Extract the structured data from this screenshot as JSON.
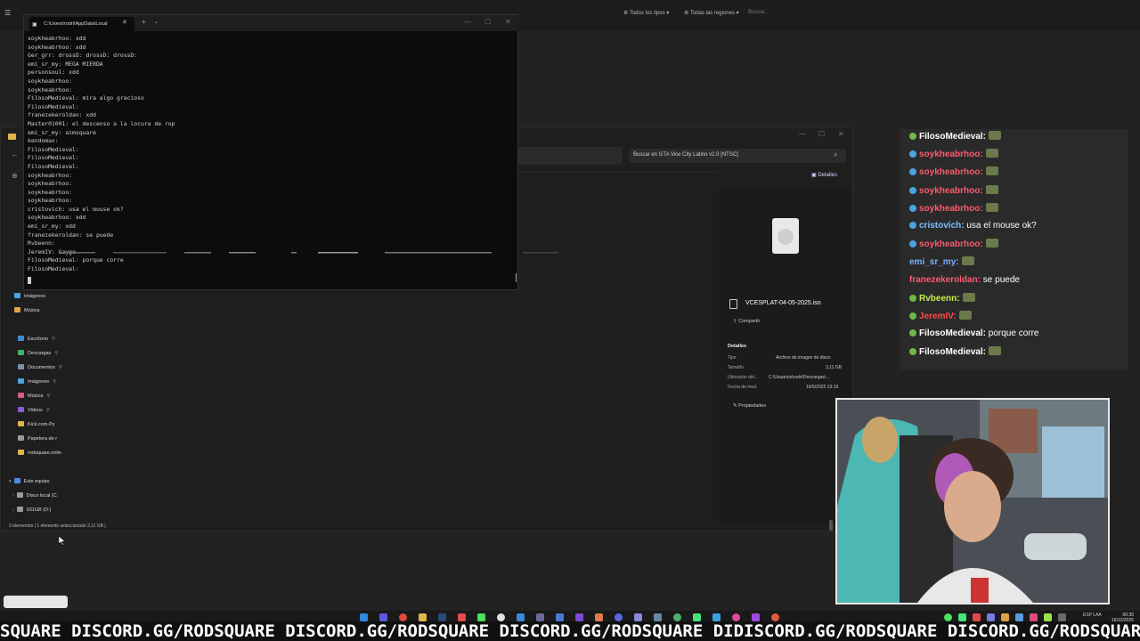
{
  "topbar": {
    "filter_types": "Todos los tipos",
    "filter_regions": "Todas las regiones",
    "search_placeholder": "Buscar..."
  },
  "terminal": {
    "tab_title": "C:\\Users\\rodri\\AppData\\Local",
    "lines": [
      "soykheabrhoo: xdd",
      "soykheabrhoo: xdd",
      "Ger_grr: drossD: drossD: drossD:",
      "emi_sr_my: MEGA MIERDA",
      "personsoul: xdd",
      "soykheabrhoo:",
      "soykheabrhoo:",
      "FilosoMedieval: mira algo gracioso",
      "FilosoMedieval:",
      "franezekeroldan: xdd",
      "Master01001: el descenso a la locura de rop",
      "emi_sr_my: aimsquare",
      "kendomax:",
      "FilosoMedieval:",
      "FilosoMedieval:",
      "FilosoMedieval:",
      "soykheabrhoo:",
      "soykheabrhoo:",
      "soykheabrhoo:",
      "soykheabrhoo:",
      "cristovich: usa el mouse ok?",
      "soykheabrhoo: xdd",
      "emi_sr_my: xdd",
      "franezekeroldan: se puede",
      "Rvbeenn:",
      "JeremIV: Gayge",
      "FilosoMedieval: porque corre",
      "FilosoMedieval:"
    ]
  },
  "explorer": {
    "search_placeholder": "Buscar en GTA Vice City Latino v2.0 [NTSC]",
    "details_button": "Detalles",
    "nav_items": [
      {
        "label": "Imágenes",
        "color": "#4aa3e0"
      },
      {
        "label": "Música",
        "color": "#e0a24a"
      },
      {
        "label": "Escritorio",
        "color": "#3d8fd8"
      },
      {
        "label": "Descargas",
        "color": "#3fb36a"
      },
      {
        "label": "Documentos",
        "color": "#7a8fb0"
      },
      {
        "label": "Imágenes",
        "color": "#4aa3e0"
      },
      {
        "label": "Música",
        "color": "#d65a8a"
      },
      {
        "label": "Videos",
        "color": "#8a5ad6"
      },
      {
        "label": "Kick.com-Py",
        "color": "#e0b64a"
      },
      {
        "label": "Papelera de r",
        "color": "#9a9a9a"
      },
      {
        "label": "rodsquare.onlin",
        "color": "#e0b64a"
      },
      {
        "label": "Este equipo",
        "color": "#4a8ee0"
      },
      {
        "label": "Disco local (C:",
        "color": "#9a9a9a"
      },
      {
        "label": "931GB (D:)",
        "color": "#9a9a9a"
      }
    ],
    "file_name": "VCESPLAT-04-05-2025.iso",
    "share_label": "Compartir",
    "details_heading": "Detalles",
    "props": [
      {
        "key": "Tipo",
        "value": "Archivo de imagen de disco"
      },
      {
        "key": "Tamaño",
        "value": "3,11 GB"
      },
      {
        "key": "Ubicación del...",
        "value": "C:\\Usuarios\\rodri\\Descargas\\..."
      },
      {
        "key": "Fecha de mod.",
        "value": "16/5/2025 13:19"
      }
    ],
    "properties_label": "Propiedades",
    "status": "3 elementos  |  1 elemento seleccionado  3,11 GB  |"
  },
  "chat": {
    "messages": [
      {
        "user": "FilosoMedieval:",
        "text": "",
        "color": "#ffffff",
        "badge": "#6fb84a",
        "emote": true
      },
      {
        "user": "soykheabrhoo:",
        "text": "",
        "color": "#ff5a6e",
        "badge": "#4aa3e0",
        "emote": true
      },
      {
        "user": "soykheabrhoo:",
        "text": "",
        "color": "#ff5a6e",
        "badge": "#4aa3e0",
        "emote": true
      },
      {
        "user": "soykheabrhoo:",
        "text": "",
        "color": "#ff5a6e",
        "badge": "#4aa3e0",
        "emote": true
      },
      {
        "user": "soykheabrhoo:",
        "text": "",
        "color": "#ff5a6e",
        "badge": "#4aa3e0",
        "emote": true
      },
      {
        "user": "cristovich:",
        "text": "usa el mouse ok?",
        "color": "#7ac0ff",
        "badge": "#4aa3e0",
        "emote": false
      },
      {
        "user": "soykheabrhoo:",
        "text": "",
        "color": "#ff5a6e",
        "badge": "#4aa3e0",
        "emote": true
      },
      {
        "user": "emi_sr_my:",
        "text": "",
        "color": "#7ab0ff",
        "badge": "",
        "emote": true
      },
      {
        "user": "franezekeroldan:",
        "text": "se puede",
        "color": "#ff5a6e",
        "badge": "",
        "emote": false
      },
      {
        "user": "Rvbeenn:",
        "text": "",
        "color": "#c8f04a",
        "badge": "#6fb84a",
        "emote": true
      },
      {
        "user": "JeremIV:",
        "text": "",
        "color": "#ff4a4a",
        "badge": "#6fb84a",
        "emote": true
      },
      {
        "user": "FilosoMedieval:",
        "text": "porque corre",
        "color": "#ffffff",
        "badge": "#6fb84a",
        "emote": false
      },
      {
        "user": "FilosoMedieval:",
        "text": "",
        "color": "#ffffff",
        "badge": "#6fb84a",
        "emote": true
      }
    ]
  },
  "ticker": {
    "text": "SQUARE DISCORD.GG/RODSQUARE DISCORD.GG/RODSQUARE DISCORD.GG/RODSQUARE DIDISCORD.GG/RODSQUARE DISCORD.GG/RODSQUARE"
  },
  "tray": {
    "keyboard": "ESP LAA",
    "time": "00:35",
    "date": "16/12/2025"
  },
  "colors": {
    "accent": "#4aa3e0",
    "terminal_bg": "#0c0c0c",
    "explorer_bg": "#1e1e1e"
  }
}
